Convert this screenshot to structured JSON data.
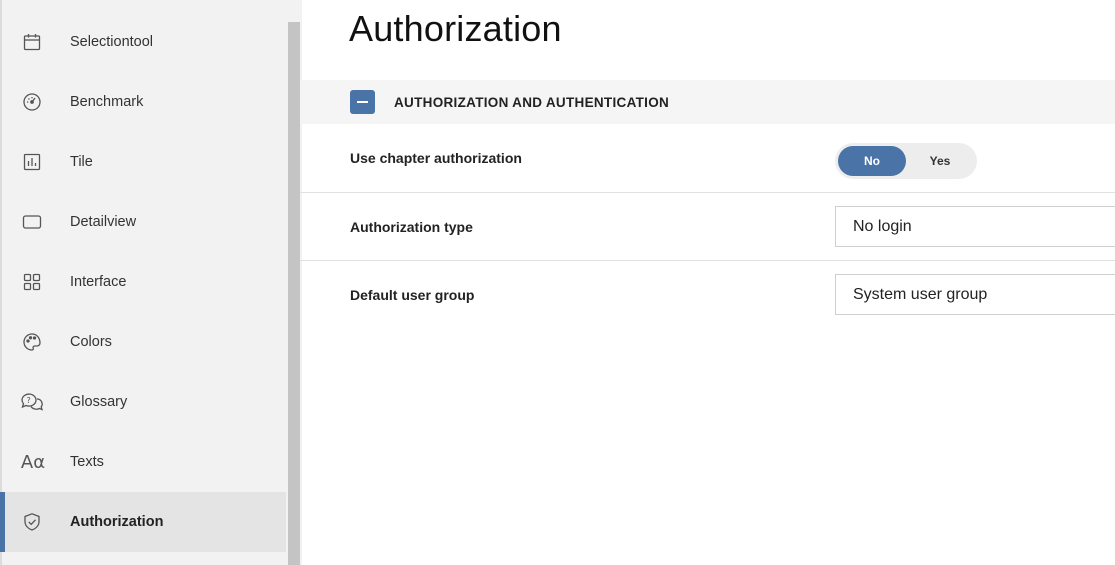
{
  "sidebar": {
    "items": [
      {
        "label": "Selectiontool",
        "icon": "calendar-icon",
        "active": false
      },
      {
        "label": "Benchmark",
        "icon": "gauge-icon",
        "active": false
      },
      {
        "label": "Tile",
        "icon": "bar-chart-icon",
        "active": false
      },
      {
        "label": "Detailview",
        "icon": "rectangle-icon",
        "active": false
      },
      {
        "label": "Interface",
        "icon": "grid-icon",
        "active": false
      },
      {
        "label": "Colors",
        "icon": "palette-icon",
        "active": false
      },
      {
        "label": "Glossary",
        "icon": "speech-bubbles-icon",
        "active": false
      },
      {
        "label": "Texts",
        "icon": "text-icon",
        "active": false
      },
      {
        "label": "Authorization",
        "icon": "shield-check-icon",
        "active": true
      }
    ],
    "texts_icon_glyph": "Aα"
  },
  "main": {
    "title": "Authorization",
    "section": {
      "title": "AUTHORIZATION AND AUTHENTICATION",
      "rows": {
        "chapter_auth": {
          "label": "Use chapter authorization",
          "toggle": {
            "no": "No",
            "yes": "Yes",
            "selected": "No"
          }
        },
        "auth_type": {
          "label": "Authorization type",
          "value": "No login"
        },
        "default_group": {
          "label": "Default user group",
          "value": "System user group"
        }
      }
    }
  },
  "colors": {
    "accent": "#4a74a8",
    "sidebar_bg": "#f2f2f2",
    "active_item_bg": "#e4e4e4"
  }
}
